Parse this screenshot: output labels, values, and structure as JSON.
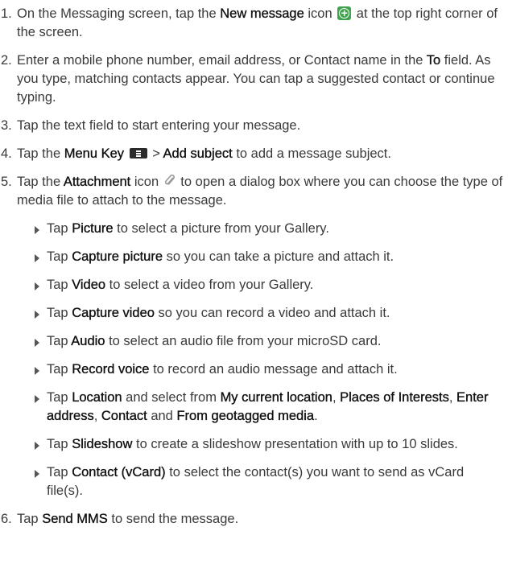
{
  "steps": [
    {
      "number": "1.",
      "parts": [
        "On the Messaging screen, tap the ",
        "New message",
        " icon ",
        " at the top right corner of the screen."
      ],
      "icon": "new-message-icon"
    },
    {
      "number": "2.",
      "parts": [
        "Enter a mobile phone number, email address, or Contact name in the ",
        "To",
        " field. As you type, matching contacts appear. You can tap a suggested contact or continue typing."
      ]
    },
    {
      "number": "3.",
      "parts": [
        "Tap the text field to start entering your message."
      ]
    },
    {
      "number": "4.",
      "parts": [
        "Tap the ",
        "Menu Key",
        " ",
        " > ",
        "Add subject",
        " to add a message subject."
      ],
      "icon": "menu-key-icon"
    },
    {
      "number": "5.",
      "parts": [
        "Tap the ",
        "Attachment",
        " icon ",
        " to open a dialog box where you can choose the type of media file to attach to the message."
      ],
      "icon": "paperclip-icon"
    },
    {
      "number": "6.",
      "parts": [
        "Tap ",
        "Send MMS",
        " to send the message."
      ]
    }
  ],
  "attachment_options": [
    {
      "parts": [
        "Tap ",
        "Picture",
        " to select a picture from your Gallery."
      ]
    },
    {
      "parts": [
        "Tap ",
        "Capture picture",
        " so you can take a picture and attach it."
      ]
    },
    {
      "parts": [
        "Tap ",
        "Video",
        " to select a video from your Gallery."
      ]
    },
    {
      "parts": [
        "Tap ",
        "Capture video",
        " so you can record a video and attach it."
      ]
    },
    {
      "parts": [
        "Tap ",
        "Audio",
        " to select an audio file from your microSD card."
      ]
    },
    {
      "parts": [
        "Tap ",
        "Record voice",
        " to record an audio message and attach it."
      ]
    },
    {
      "parts": [
        "Tap ",
        "Location",
        " and select from ",
        "My current location",
        ", ",
        "Places of Interests",
        ", ",
        "Enter address",
        ", ",
        "Contact",
        " and ",
        "From geotagged media",
        "."
      ]
    },
    {
      "parts": [
        "Tap ",
        "Slideshow",
        " to create a slideshow presentation with up to 10 slides."
      ]
    },
    {
      "parts": [
        "Tap ",
        "Contact (vCard)",
        " to select the contact(s) you want to send as vCard file(s)."
      ]
    }
  ],
  "colors": {
    "body_text": "#3a3a3a",
    "bold_text": "#111111",
    "new_message_icon": "#3fa34d",
    "menu_key_icon": "#2b2b2b"
  }
}
